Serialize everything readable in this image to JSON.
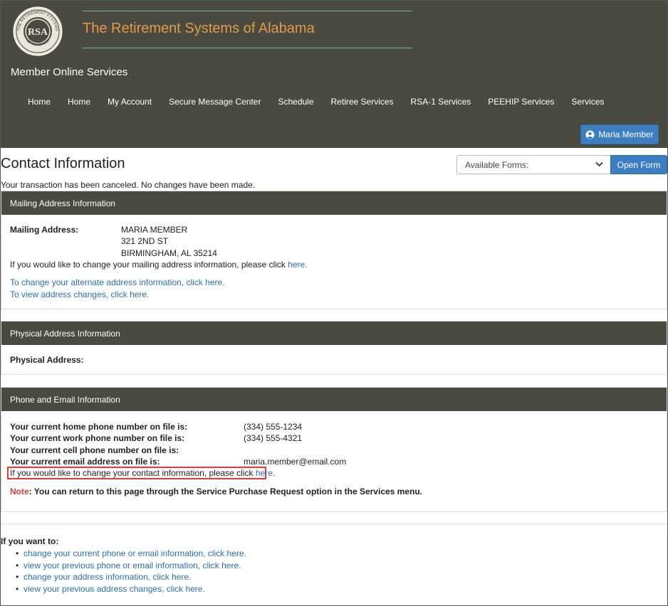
{
  "header": {
    "brand_title": "The Retirement Systems of Alabama",
    "logo_text_top": "THE RETIREMENT SYSTEMS",
    "logo_text_bottom": "OF ALABAMA",
    "logo_center": "RSA",
    "subtitle": "Member Online Services",
    "nav": [
      "Home",
      "Home",
      "My Account",
      "Secure Message Center",
      "Schedule",
      "Retiree Services",
      "RSA-1 Services",
      "PEEHIP Services",
      "Services"
    ],
    "user_button": "Maria Member",
    "colors": {
      "header_bg": "#4b4a40",
      "brand_orange": "#e09a48",
      "accent_teal": "#6fb3a3",
      "button_blue": "#3d7ec2"
    }
  },
  "page": {
    "title": "Contact Information",
    "forms_select": "Available Forms:",
    "open_form_button": "Open Form",
    "cancel_message": "Your transaction has been canceled. No changes have been made."
  },
  "mailing": {
    "header": "Mailing Address Information",
    "label": "Mailing Address:",
    "address_lines": [
      "MARIA MEMBER",
      "321 2ND ST",
      "BIRMINGHAM, AL 35214"
    ],
    "change_text": "If you would like to change your mailing address information, please click ",
    "change_link": "here.",
    "alt_address_link": "To change your alternate address information, click here.",
    "view_changes_link": "To view address changes, click here."
  },
  "physical": {
    "header": "Physical Address Information",
    "label": "Physical Address:"
  },
  "contact": {
    "header": "Phone and Email Information",
    "rows": [
      {
        "label": "Your current home phone number on file is:",
        "value": "(334) 555-1234"
      },
      {
        "label": "Your current work phone number on file is:",
        "value": "(334) 555-4321"
      },
      {
        "label": "Your current cell phone number on file is:",
        "value": ""
      },
      {
        "label": "Your current email address on file is:",
        "value": "maria.member@email.com"
      }
    ],
    "change_text": "If you would like to change your contact information, please click ",
    "change_link": "here.",
    "note_label": "Note",
    "note_text": ": You can return to this page through the Service Purchase Request option in the Services menu."
  },
  "want": {
    "title": "If you want to:",
    "items": [
      "change your current phone or email information, click here.",
      "view your previous phone or email information, click here.",
      "change your address information, click here.",
      "view your previous address changes, click here."
    ]
  }
}
